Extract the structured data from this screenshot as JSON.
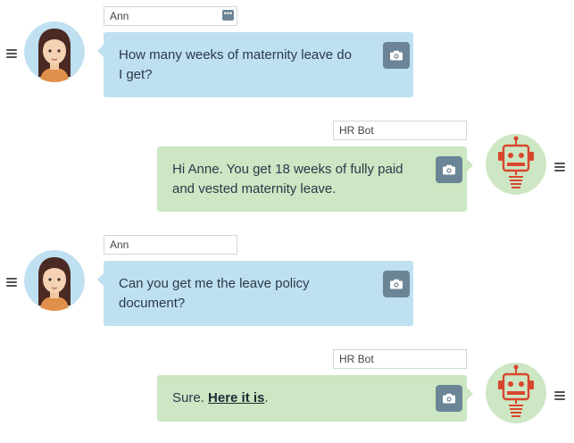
{
  "conversation": [
    {
      "sender": "user",
      "name": "Ann",
      "lines": [
        "How many weeks of maternity leave do",
        "I get?"
      ],
      "has_options_button": true,
      "options_icon": "ellipsis-icon",
      "avatar_icon": "woman-avatar-icon"
    },
    {
      "sender": "bot",
      "name": "HR Bot",
      "lines": [
        "Hi Anne. You get 18 weeks of fully paid",
        "and vested maternity leave."
      ],
      "avatar_icon": "robot-avatar-icon"
    },
    {
      "sender": "user",
      "name": "Ann",
      "lines": [
        "Can you get me the leave policy",
        "document?"
      ],
      "avatar_icon": "woman-avatar-icon"
    },
    {
      "sender": "bot",
      "name": "HR Bot",
      "prefix": "Sure. ",
      "link": "Here it is",
      "suffix": ".",
      "avatar_icon": "robot-avatar-icon"
    }
  ],
  "icons": {
    "menu": "hamburger-menu-icon",
    "bubble_action": "camera-icon"
  },
  "colors": {
    "user_bubble": "#bfe0f1",
    "bot_bubble": "#cde6c3",
    "user_avatar_bg": "#bfe0f1",
    "bot_avatar_bg": "#cde6c3",
    "robot": "#d9462e",
    "action_button": "#6b8596"
  }
}
